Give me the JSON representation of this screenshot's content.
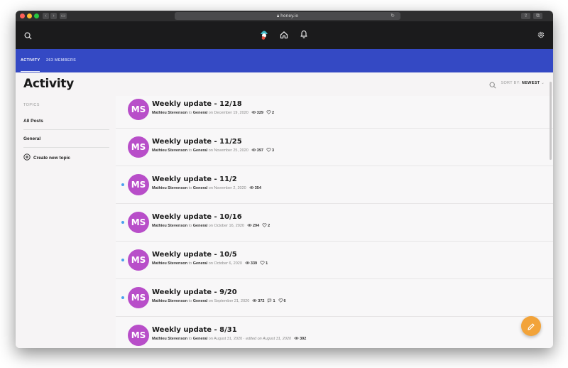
{
  "browser": {
    "url": "honey.io"
  },
  "tabs": {
    "activity": "ACTIVITY",
    "members": "263 MEMBERS"
  },
  "header": {
    "title": "Activity",
    "sort_prefix": "SORT BY:",
    "sort_value": "NEWEST"
  },
  "sidebar": {
    "heading": "TOPICS",
    "items": [
      {
        "label": "All Posts"
      },
      {
        "label": "General"
      }
    ],
    "create_label": "Create new topic"
  },
  "posts": [
    {
      "initials": "MS",
      "title": "Weekly update - 12/18",
      "author": "Mathieu Stevenson",
      "to": "to",
      "topic": "General",
      "date": "on December 19, 2020",
      "edited": "",
      "views": "329",
      "comments": "",
      "likes": "2",
      "unread": false
    },
    {
      "initials": "MS",
      "title": "Weekly update - 11/25",
      "author": "Mathieu Stevenson",
      "to": "to",
      "topic": "General",
      "date": "on November 25, 2020",
      "edited": "",
      "views": "397",
      "comments": "",
      "likes": "3",
      "unread": false
    },
    {
      "initials": "MS",
      "title": "Weekly update - 11/2",
      "author": "Mathieu Stevenson",
      "to": "to",
      "topic": "General",
      "date": "on November 2, 2020",
      "edited": "",
      "views": "354",
      "comments": "",
      "likes": "",
      "unread": true
    },
    {
      "initials": "MS",
      "title": "Weekly update - 10/16",
      "author": "Mathieu Stevenson",
      "to": "to",
      "topic": "General",
      "date": "on October 16, 2020",
      "edited": "",
      "views": "294",
      "comments": "",
      "likes": "2",
      "unread": true
    },
    {
      "initials": "MS",
      "title": "Weekly update - 10/5",
      "author": "Mathieu Stevenson",
      "to": "to",
      "topic": "General",
      "date": "on October 6, 2020",
      "edited": "",
      "views": "339",
      "comments": "",
      "likes": "1",
      "unread": true
    },
    {
      "initials": "MS",
      "title": "Weekly update - 9/20",
      "author": "Mathieu Stevenson",
      "to": "to",
      "topic": "General",
      "date": "on September 21, 2020",
      "edited": "",
      "views": "372",
      "comments": "1",
      "likes": "6",
      "unread": true
    },
    {
      "initials": "MS",
      "title": "Weekly update - 8/31",
      "author": "Mathieu Stevenson",
      "to": "to",
      "topic": "General",
      "date": "on August 31, 2020",
      "edited": "· edited on August 31, 2020",
      "views": "392",
      "comments": "",
      "likes": "",
      "unread": false
    }
  ],
  "colors": {
    "accent_blue": "#3449c4",
    "avatar": "#b84ec9",
    "fab": "#f2a33a",
    "unread": "#4aa0ee"
  },
  "icons": [
    "search-icon",
    "logo-icon",
    "home-icon",
    "bell-icon",
    "settings-icon",
    "plus-circle-icon",
    "eye-icon",
    "comment-icon",
    "heart-icon",
    "pencil-icon"
  ]
}
